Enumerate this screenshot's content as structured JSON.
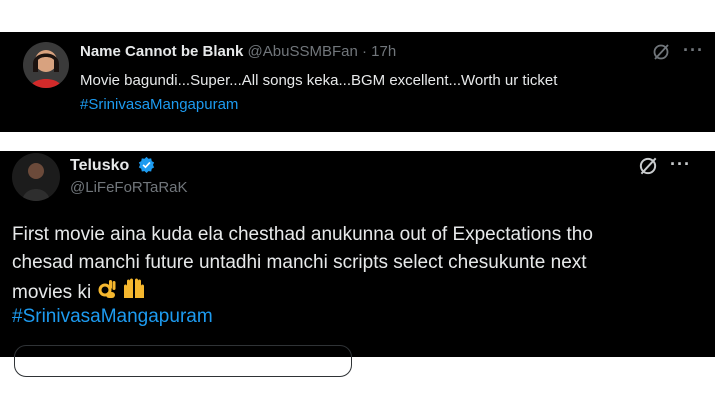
{
  "tweets": [
    {
      "display_name": "Name Cannot be Blank",
      "handle": "@AbuSSMBFan",
      "separator": "·",
      "time": "17h",
      "text": "Movie bagundi...Super...All songs keka...BGM excellent...Worth ur ticket",
      "hashtag": "#SrinivasaMangapuram",
      "icons": [
        "grok-icon",
        "more-icon",
        "avatar"
      ]
    },
    {
      "display_name": "Telusko",
      "handle": "@LiFeFoRTaRaK",
      "verified": true,
      "text_lines": [
        "First movie aina kuda ela chesthad anukunna out of Expectations tho",
        "chesad manchi future untadhi manchi scripts select chesukunte next",
        "movies ki"
      ],
      "hashtag": "#SrinivasaMangapuram",
      "icons": [
        "grok-icon",
        "more-icon",
        "verified-badge-icon",
        "ok-hand-emoji",
        "raised-hands-emoji",
        "avatar"
      ]
    }
  ],
  "colors": {
    "background": "#000000",
    "text": "#e7e9ea",
    "muted": "#71767b",
    "accent": "#1d9bf0",
    "page": "#ffffff"
  }
}
